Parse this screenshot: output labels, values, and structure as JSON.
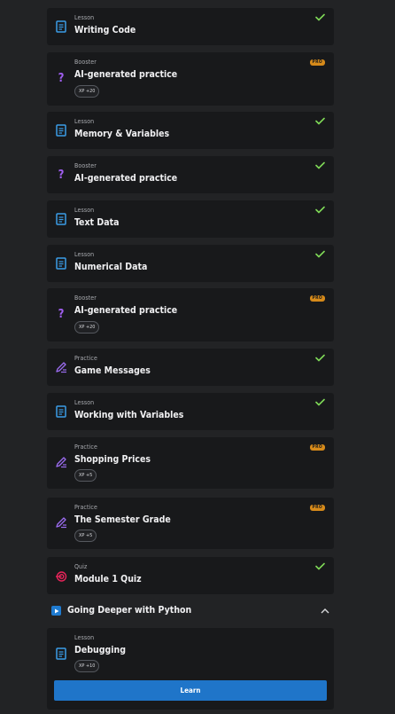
{
  "items": [
    {
      "type": "Lesson",
      "title": "Writing Code",
      "status": "check",
      "icon": "lesson-doc-icon"
    },
    {
      "type": "Booster",
      "title": "AI-generated practice",
      "status": "pro",
      "xp": "XP +20",
      "icon": "question-icon"
    },
    {
      "type": "Lesson",
      "title": "Memory & Variables",
      "status": "check",
      "icon": "lesson-doc-icon"
    },
    {
      "type": "Booster",
      "title": "AI-generated practice",
      "status": "check",
      "icon": "question-icon"
    },
    {
      "type": "Lesson",
      "title": "Text Data",
      "status": "check",
      "icon": "lesson-doc-icon"
    },
    {
      "type": "Lesson",
      "title": "Numerical Data",
      "status": "check",
      "icon": "lesson-doc-icon"
    },
    {
      "type": "Booster",
      "title": "AI-generated practice",
      "status": "pro",
      "xp": "XP +20",
      "icon": "question-icon"
    },
    {
      "type": "Practice",
      "title": "Game Messages",
      "status": "check",
      "icon": "pencil-icon"
    },
    {
      "type": "Lesson",
      "title": "Working with Variables",
      "status": "check",
      "icon": "lesson-doc-icon"
    },
    {
      "type": "Practice",
      "title": "Shopping Prices",
      "status": "pro",
      "xp": "XP +5",
      "icon": "pencil-icon"
    },
    {
      "type": "Practice",
      "title": "The Semester Grade",
      "status": "pro",
      "xp": "XP +5",
      "icon": "pencil-icon"
    },
    {
      "type": "Quiz",
      "title": "Module 1 Quiz",
      "status": "check",
      "icon": "target-icon"
    }
  ],
  "pro_label": "PRO",
  "section": {
    "title": "Going Deeper with Python",
    "icon": "play-icon",
    "expanded_icon": "chevron-up-icon"
  },
  "next": {
    "type": "Lesson",
    "title": "Debugging",
    "xp": "XP +10",
    "button": "Learn",
    "icon": "lesson-doc-icon"
  },
  "colors": {
    "check": "#7fd957",
    "pro": "#d68a1a",
    "lesson_icon": "#3a9de8",
    "booster_icon": "#a05ef0",
    "practice_icon": "#9b6cf0",
    "quiz_icon": "#e8245a",
    "button": "#1f75c9"
  }
}
